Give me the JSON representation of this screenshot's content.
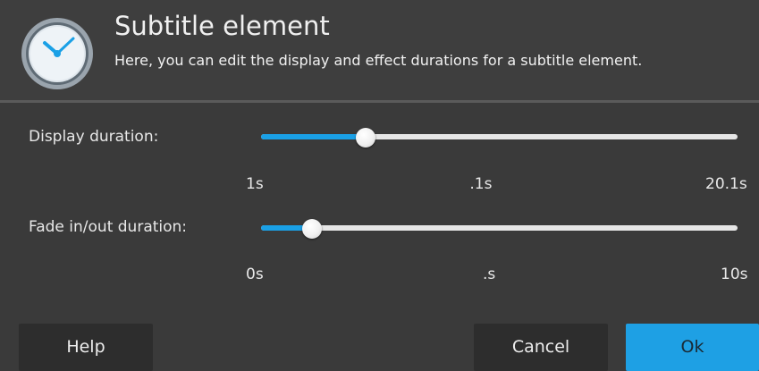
{
  "header": {
    "title": "Subtitle element",
    "description": "Here, you can edit the display and effect durations for a subtitle element.",
    "icon": "clock-icon"
  },
  "display_duration": {
    "label": "Display duration:",
    "value_fraction": 0.22,
    "tick_min": "1s",
    "tick_mid": " .1s",
    "tick_max": "20.1s"
  },
  "fade_duration": {
    "label": "Fade in/out duration:",
    "value_fraction": 0.107,
    "tick_min": "0s",
    "tick_mid": ".s",
    "tick_max": "10s"
  },
  "buttons": {
    "help": "Help",
    "cancel": "Cancel",
    "ok": "Ok"
  },
  "colors": {
    "accent": "#1aa0e6",
    "background": "#3a3a3a",
    "button_dark": "#2d2d2d"
  }
}
